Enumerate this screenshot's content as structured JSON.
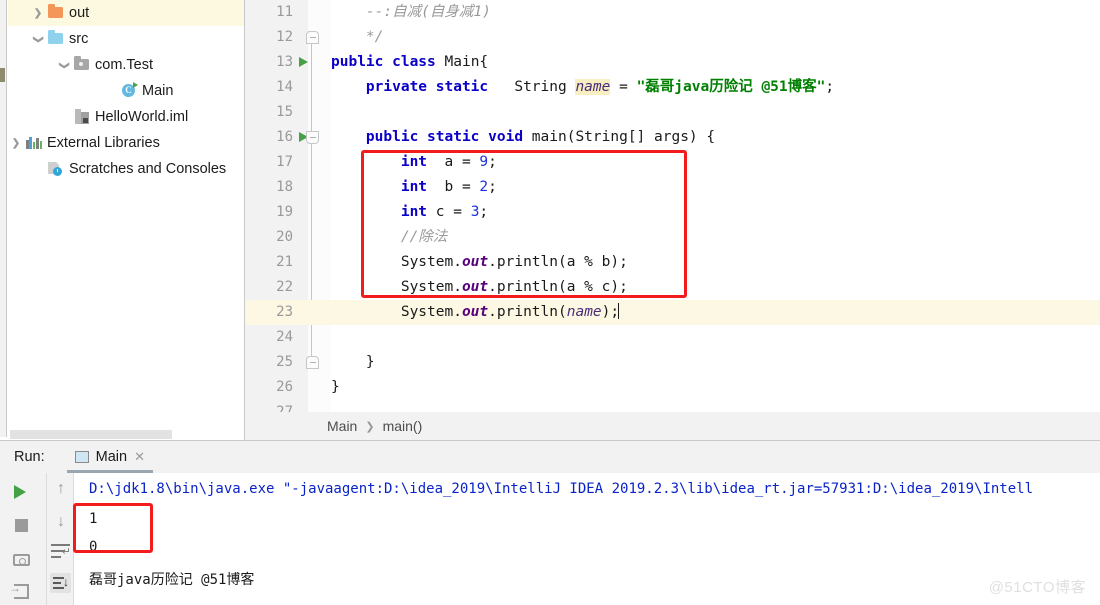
{
  "project_tree": {
    "items": [
      {
        "label": "out",
        "icon": "folder-orange-icon",
        "arrow": "right",
        "indent": 22,
        "selected": true
      },
      {
        "label": "src",
        "icon": "folder-blue-icon",
        "arrow": "down",
        "indent": 22,
        "selected": false
      },
      {
        "label": "com.Test",
        "icon": "folder-package-icon",
        "arrow": "down",
        "indent": 48,
        "selected": false
      },
      {
        "label": "Main",
        "icon": "java-class-icon",
        "arrow": "none",
        "indent": 95,
        "selected": false
      },
      {
        "label": "HelloWorld.iml",
        "icon": "module-file-icon",
        "arrow": "none",
        "indent": 48,
        "selected": false
      },
      {
        "label": "External Libraries",
        "icon": "libraries-icon",
        "arrow": "right",
        "indent": 0,
        "selected": false
      },
      {
        "label": "Scratches and Consoles",
        "icon": "scratches-icon",
        "arrow": "none",
        "indent": 22,
        "selected": false
      }
    ]
  },
  "editor": {
    "first_line": 11,
    "current_line": 23,
    "lines": [
      {
        "n": 11,
        "run_marker": false,
        "fold": "none",
        "segments": [
          {
            "t": "    --:自减(自身减1)",
            "c": "cmt"
          }
        ]
      },
      {
        "n": 12,
        "run_marker": false,
        "fold": "up",
        "segments": [
          {
            "t": "    */",
            "c": "cmt"
          }
        ]
      },
      {
        "n": 13,
        "run_marker": true,
        "fold": "none",
        "segments": [
          {
            "t": "public class ",
            "c": "kw"
          },
          {
            "t": "Main{",
            "c": ""
          }
        ]
      },
      {
        "n": 14,
        "run_marker": false,
        "fold": "none",
        "segments": [
          {
            "t": "    private static ",
            "c": "kw"
          },
          {
            "t": "  String ",
            "c": ""
          },
          {
            "t": "name",
            "c": "hl"
          },
          {
            "t": " = ",
            "c": ""
          },
          {
            "t": "\"磊哥java历险记 @51博客\"",
            "c": "str"
          },
          {
            "t": ";",
            "c": ""
          }
        ]
      },
      {
        "n": 15,
        "run_marker": false,
        "fold": "none",
        "segments": []
      },
      {
        "n": 16,
        "run_marker": true,
        "fold": "down",
        "segments": [
          {
            "t": "    public static void ",
            "c": "kw"
          },
          {
            "t": "main(String[] args) {",
            "c": ""
          }
        ]
      },
      {
        "n": 17,
        "run_marker": false,
        "fold": "none",
        "segments": [
          {
            "t": "        int ",
            "c": "kw"
          },
          {
            "t": " a = ",
            "c": ""
          },
          {
            "t": "9",
            "c": "num"
          },
          {
            "t": ";",
            "c": ""
          }
        ]
      },
      {
        "n": 18,
        "run_marker": false,
        "fold": "none",
        "segments": [
          {
            "t": "        int ",
            "c": "kw"
          },
          {
            "t": " b = ",
            "c": ""
          },
          {
            "t": "2",
            "c": "num"
          },
          {
            "t": ";",
            "c": ""
          }
        ]
      },
      {
        "n": 19,
        "run_marker": false,
        "fold": "none",
        "segments": [
          {
            "t": "        int ",
            "c": "kw"
          },
          {
            "t": "c = ",
            "c": ""
          },
          {
            "t": "3",
            "c": "num"
          },
          {
            "t": ";",
            "c": ""
          }
        ]
      },
      {
        "n": 20,
        "run_marker": false,
        "fold": "none",
        "segments": [
          {
            "t": "        //除法",
            "c": "cmt"
          }
        ]
      },
      {
        "n": 21,
        "run_marker": false,
        "fold": "none",
        "segments": [
          {
            "t": "        System.",
            "c": ""
          },
          {
            "t": "out",
            "c": "fld"
          },
          {
            "t": ".println(a % b);",
            "c": ""
          }
        ]
      },
      {
        "n": 22,
        "run_marker": false,
        "fold": "none",
        "segments": [
          {
            "t": "        System.",
            "c": ""
          },
          {
            "t": "out",
            "c": "fld"
          },
          {
            "t": ".println(a % c);",
            "c": ""
          }
        ]
      },
      {
        "n": 23,
        "run_marker": false,
        "fold": "none",
        "segments": [
          {
            "t": "        System.",
            "c": ""
          },
          {
            "t": "out",
            "c": "fld"
          },
          {
            "t": ".println(",
            "c": ""
          },
          {
            "t": "name",
            "c": "var"
          },
          {
            "t": ");",
            "c": ""
          }
        ]
      },
      {
        "n": 24,
        "run_marker": false,
        "fold": "none",
        "segments": []
      },
      {
        "n": 25,
        "run_marker": false,
        "fold": "up",
        "segments": [
          {
            "t": "    }",
            "c": ""
          }
        ]
      },
      {
        "n": 26,
        "run_marker": false,
        "fold": "none",
        "segments": [
          {
            "t": "}",
            "c": ""
          }
        ]
      },
      {
        "n": 27,
        "run_marker": false,
        "fold": "none",
        "segments": []
      }
    ]
  },
  "breadcrumb": {
    "class": "Main",
    "separator": "❯",
    "method": "main()"
  },
  "run_panel": {
    "label": "Run:",
    "tab_name": "Main",
    "tab_close": "✕",
    "console_lines": [
      {
        "text": "D:\\jdk1.8\\bin\\java.exe \"-javaagent:D:\\idea_2019\\IntelliJ IDEA 2019.2.3\\lib\\idea_rt.jar=57931:D:\\idea_2019\\Intell",
        "kind": "cmd"
      },
      {
        "text": "1",
        "kind": "out"
      },
      {
        "text": "0",
        "kind": "out"
      },
      {
        "text": "磊哥java历险记 @51博客",
        "kind": "out"
      }
    ],
    "buttons": [
      {
        "name": "run-button",
        "icon": "play-icon"
      },
      {
        "name": "stop-button",
        "icon": "stop-icon"
      },
      {
        "name": "screenshot-button",
        "icon": "camera-icon"
      },
      {
        "name": "import-button",
        "icon": "arrow-into-icon"
      }
    ],
    "side_buttons": [
      {
        "name": "scroll-up-button",
        "icon": "arrow-up-icon",
        "glyph": "↑"
      },
      {
        "name": "scroll-down-button",
        "icon": "arrow-down-icon",
        "glyph": "↓"
      },
      {
        "name": "soft-wrap-button",
        "icon": "soft-wrap-icon",
        "glyph": ""
      },
      {
        "name": "scroll-to-end-button",
        "icon": "scroll-end-icon",
        "glyph": ""
      }
    ]
  },
  "watermark": "@51CTO博客",
  "colors": {
    "keyword": "#0a00c8",
    "string": "#008000",
    "number": "#1c32e0",
    "comment": "#9a9a9a",
    "static_field": "#58007a",
    "annotation_box": "#f31c1c",
    "current_line": "#fdf8e3",
    "selected_row": "#fdf9e0",
    "console_command": "#0a23c8"
  }
}
